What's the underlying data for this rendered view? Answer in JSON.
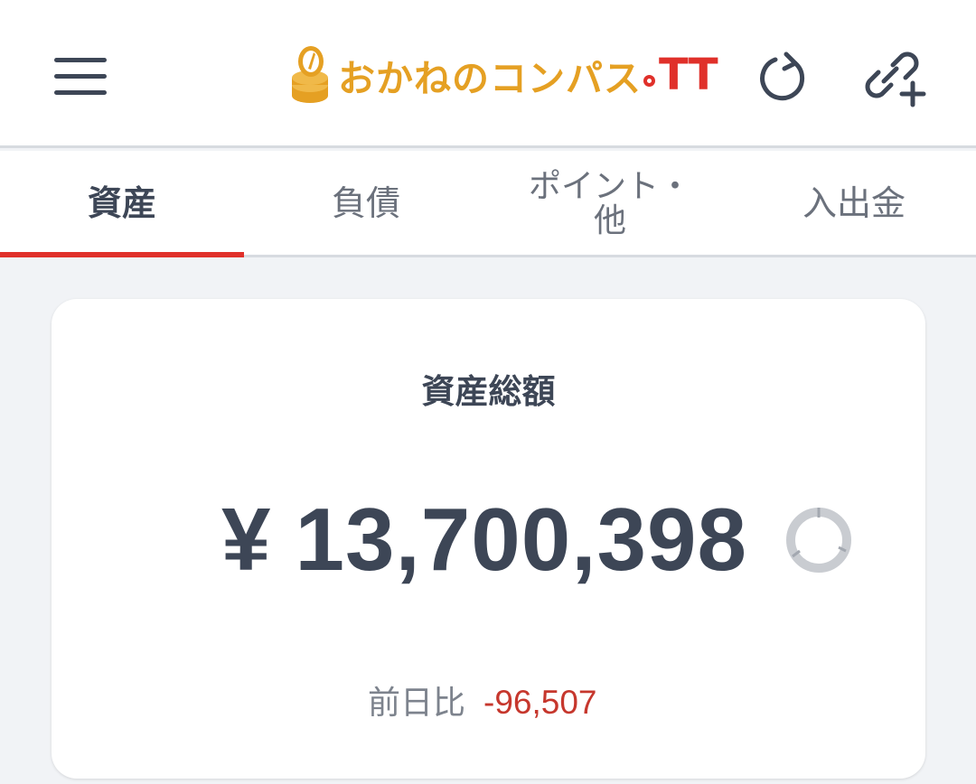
{
  "header": {
    "logo_text": "おかねのコンパス",
    "logo_suffix": "TT",
    "menu_icon": "hamburger-menu-icon",
    "refresh_icon": "refresh-icon",
    "link_icon": "link-add-icon"
  },
  "tabs": [
    {
      "label": "資産",
      "active": true
    },
    {
      "label": "負債",
      "active": false
    },
    {
      "label": "ポイント・他",
      "line1": "ポイント・",
      "line2": "他",
      "active": false
    },
    {
      "label": "入出金",
      "active": false
    }
  ],
  "summary": {
    "title": "資産総額",
    "currency": "¥",
    "amount": "13,700,398",
    "diff_label": "前日比",
    "diff_value": "-96,507",
    "chart_icon": "donut-chart-icon"
  },
  "colors": {
    "accent": "#e0302a",
    "logo_gold": "#e5a023",
    "text_dark": "#3d4656",
    "negative": "#c6372d",
    "background": "#f1f3f6"
  }
}
